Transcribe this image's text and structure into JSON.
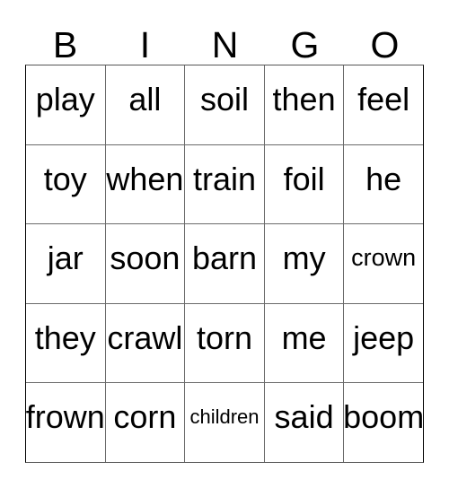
{
  "card": {
    "header_letters": [
      "B",
      "I",
      "N",
      "G",
      "O"
    ],
    "background_color": "#ffffff",
    "text_color": "#000000",
    "border_color": "#000000",
    "grid_line_color": "#6a6a6a",
    "rows": [
      {
        "cells": [
          {
            "word": "play",
            "size": "lg"
          },
          {
            "word": "all",
            "size": "lg"
          },
          {
            "word": "soil",
            "size": "lg"
          },
          {
            "word": "then",
            "size": "lg"
          },
          {
            "word": "feel",
            "size": "lg"
          }
        ]
      },
      {
        "cells": [
          {
            "word": "toy",
            "size": "lg"
          },
          {
            "word": "when",
            "size": "lg"
          },
          {
            "word": "train",
            "size": "lg"
          },
          {
            "word": "foil",
            "size": "lg"
          },
          {
            "word": "he",
            "size": "lg"
          }
        ]
      },
      {
        "cells": [
          {
            "word": "jar",
            "size": "lg"
          },
          {
            "word": "soon",
            "size": "lg"
          },
          {
            "word": "barn",
            "size": "lg"
          },
          {
            "word": "my",
            "size": "lg"
          },
          {
            "word": "crown",
            "size": "md"
          }
        ]
      },
      {
        "cells": [
          {
            "word": "they",
            "size": "lg"
          },
          {
            "word": "crawl",
            "size": "lg"
          },
          {
            "word": "torn",
            "size": "lg"
          },
          {
            "word": "me",
            "size": "lg"
          },
          {
            "word": "jeep",
            "size": "lg"
          }
        ]
      },
      {
        "cells": [
          {
            "word": "frown",
            "size": "lg"
          },
          {
            "word": "corn",
            "size": "lg"
          },
          {
            "word": "children",
            "size": "sm"
          },
          {
            "word": "said",
            "size": "lg"
          },
          {
            "word": "boom",
            "size": "lg"
          }
        ]
      }
    ]
  }
}
